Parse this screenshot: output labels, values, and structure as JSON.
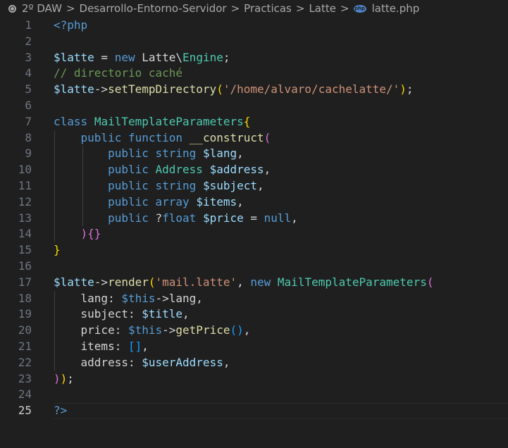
{
  "breadcrumb": {
    "items": [
      "2º DAW",
      "Desarrollo-Entorno-Servidor",
      "Practicas",
      "Latte",
      "latte.php"
    ],
    "separator": ">",
    "file_icon_label": "php"
  },
  "editor": {
    "current_line": 25,
    "lines": [
      {
        "n": "1",
        "tokens": [
          {
            "t": "<?php",
            "c": "kw"
          }
        ]
      },
      {
        "n": "2",
        "tokens": []
      },
      {
        "n": "3",
        "tokens": [
          {
            "t": "$latte",
            "c": "var"
          },
          {
            "t": " = ",
            "c": "txt"
          },
          {
            "t": "new",
            "c": "kw"
          },
          {
            "t": " Latte\\",
            "c": "txt"
          },
          {
            "t": "Engine",
            "c": "cls"
          },
          {
            "t": ";",
            "c": "txt"
          }
        ]
      },
      {
        "n": "4",
        "tokens": [
          {
            "t": "// directorio caché",
            "c": "cmt"
          }
        ]
      },
      {
        "n": "5",
        "tokens": [
          {
            "t": "$latte",
            "c": "var"
          },
          {
            "t": "->",
            "c": "txt"
          },
          {
            "t": "setTempDirectory",
            "c": "fn"
          },
          {
            "t": "(",
            "c": "b1"
          },
          {
            "t": "'/home/alvaro/cachelatte/'",
            "c": "str"
          },
          {
            "t": ")",
            "c": "b1"
          },
          {
            "t": ";",
            "c": "txt"
          }
        ]
      },
      {
        "n": "6",
        "tokens": []
      },
      {
        "n": "7",
        "tokens": [
          {
            "t": "class",
            "c": "kw"
          },
          {
            "t": " ",
            "c": "txt"
          },
          {
            "t": "MailTemplateParameters",
            "c": "cls"
          },
          {
            "t": "{",
            "c": "b1"
          }
        ]
      },
      {
        "n": "8",
        "guides": 1,
        "tokens": [
          {
            "t": "    ",
            "c": "txt"
          },
          {
            "t": "public",
            "c": "kw"
          },
          {
            "t": " ",
            "c": "txt"
          },
          {
            "t": "function",
            "c": "kw"
          },
          {
            "t": " ",
            "c": "txt"
          },
          {
            "t": "__construct",
            "c": "fn"
          },
          {
            "t": "(",
            "c": "b2"
          }
        ]
      },
      {
        "n": "9",
        "guides": 2,
        "tokens": [
          {
            "t": "        ",
            "c": "txt"
          },
          {
            "t": "public",
            "c": "kw"
          },
          {
            "t": " ",
            "c": "txt"
          },
          {
            "t": "string",
            "c": "kw"
          },
          {
            "t": " ",
            "c": "txt"
          },
          {
            "t": "$lang",
            "c": "var"
          },
          {
            "t": ",",
            "c": "txt"
          }
        ]
      },
      {
        "n": "10",
        "guides": 2,
        "tokens": [
          {
            "t": "        ",
            "c": "txt"
          },
          {
            "t": "public",
            "c": "kw"
          },
          {
            "t": " ",
            "c": "txt"
          },
          {
            "t": "Address",
            "c": "cls"
          },
          {
            "t": " ",
            "c": "txt"
          },
          {
            "t": "$address",
            "c": "var"
          },
          {
            "t": ",",
            "c": "txt"
          }
        ]
      },
      {
        "n": "11",
        "guides": 2,
        "tokens": [
          {
            "t": "        ",
            "c": "txt"
          },
          {
            "t": "public",
            "c": "kw"
          },
          {
            "t": " ",
            "c": "txt"
          },
          {
            "t": "string",
            "c": "kw"
          },
          {
            "t": " ",
            "c": "txt"
          },
          {
            "t": "$subject",
            "c": "var"
          },
          {
            "t": ",",
            "c": "txt"
          }
        ]
      },
      {
        "n": "12",
        "guides": 2,
        "tokens": [
          {
            "t": "        ",
            "c": "txt"
          },
          {
            "t": "public",
            "c": "kw"
          },
          {
            "t": " ",
            "c": "txt"
          },
          {
            "t": "array",
            "c": "kw"
          },
          {
            "t": " ",
            "c": "txt"
          },
          {
            "t": "$items",
            "c": "var"
          },
          {
            "t": ",",
            "c": "txt"
          }
        ]
      },
      {
        "n": "13",
        "guides": 2,
        "tokens": [
          {
            "t": "        ",
            "c": "txt"
          },
          {
            "t": "public",
            "c": "kw"
          },
          {
            "t": " ?",
            "c": "txt"
          },
          {
            "t": "float",
            "c": "kw"
          },
          {
            "t": " ",
            "c": "txt"
          },
          {
            "t": "$price",
            "c": "var"
          },
          {
            "t": " = ",
            "c": "txt"
          },
          {
            "t": "null",
            "c": "kw"
          },
          {
            "t": ",",
            "c": "txt"
          }
        ]
      },
      {
        "n": "14",
        "guides": 1,
        "tokens": [
          {
            "t": "    ",
            "c": "txt"
          },
          {
            "t": ")",
            "c": "b2"
          },
          {
            "t": "{}",
            "c": "b2"
          }
        ]
      },
      {
        "n": "15",
        "tokens": [
          {
            "t": "}",
            "c": "b1"
          }
        ]
      },
      {
        "n": "16",
        "tokens": []
      },
      {
        "n": "17",
        "tokens": [
          {
            "t": "$latte",
            "c": "var"
          },
          {
            "t": "->",
            "c": "txt"
          },
          {
            "t": "render",
            "c": "fn"
          },
          {
            "t": "(",
            "c": "b1"
          },
          {
            "t": "'mail.latte'",
            "c": "str"
          },
          {
            "t": ", ",
            "c": "txt"
          },
          {
            "t": "new",
            "c": "kw"
          },
          {
            "t": " ",
            "c": "txt"
          },
          {
            "t": "MailTemplateParameters",
            "c": "cls"
          },
          {
            "t": "(",
            "c": "b2"
          }
        ]
      },
      {
        "n": "18",
        "guides": 1,
        "tokens": [
          {
            "t": "    lang: ",
            "c": "txt"
          },
          {
            "t": "$this",
            "c": "kw"
          },
          {
            "t": "->",
            "c": "txt"
          },
          {
            "t": "lang",
            "c": "txt"
          },
          {
            "t": ",",
            "c": "txt"
          }
        ]
      },
      {
        "n": "19",
        "guides": 1,
        "tokens": [
          {
            "t": "    subject: ",
            "c": "txt"
          },
          {
            "t": "$title",
            "c": "var"
          },
          {
            "t": ",",
            "c": "txt"
          }
        ]
      },
      {
        "n": "20",
        "guides": 1,
        "tokens": [
          {
            "t": "    price: ",
            "c": "txt"
          },
          {
            "t": "$this",
            "c": "kw"
          },
          {
            "t": "->",
            "c": "txt"
          },
          {
            "t": "getPrice",
            "c": "fn"
          },
          {
            "t": "()",
            "c": "b3"
          },
          {
            "t": ",",
            "c": "txt"
          }
        ]
      },
      {
        "n": "21",
        "guides": 1,
        "tokens": [
          {
            "t": "    items: ",
            "c": "txt"
          },
          {
            "t": "[]",
            "c": "b3"
          },
          {
            "t": ",",
            "c": "txt"
          }
        ]
      },
      {
        "n": "22",
        "guides": 1,
        "tokens": [
          {
            "t": "    address: ",
            "c": "txt"
          },
          {
            "t": "$userAddress",
            "c": "var"
          },
          {
            "t": ",",
            "c": "txt"
          }
        ]
      },
      {
        "n": "23",
        "tokens": [
          {
            "t": ")",
            "c": "b2"
          },
          {
            "t": ")",
            "c": "b1"
          },
          {
            "t": ";",
            "c": "txt"
          }
        ]
      },
      {
        "n": "24",
        "tokens": []
      },
      {
        "n": "25",
        "tokens": [
          {
            "t": "?>",
            "c": "kw"
          }
        ]
      }
    ]
  }
}
